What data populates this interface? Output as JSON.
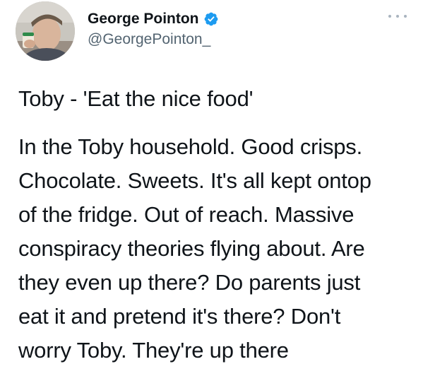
{
  "author": {
    "display_name": "George Pointon",
    "handle": "@GeorgePointon_",
    "verified_icon": "verified-badge-icon",
    "verified_color": "#1d9bf0"
  },
  "menu": {
    "icon": "more-options-icon"
  },
  "tweet": {
    "title": "Toby - 'Eat the nice food'",
    "body": "In the Toby household. Good crisps.\nChocolate. Sweets. It's all kept ontop\nof the fridge. Out of reach. Massive\nconspiracy theories flying about. Are\nthey even up there? Do parents just\neat it and pretend it's there? Don't\nworry Toby. They're up there"
  }
}
